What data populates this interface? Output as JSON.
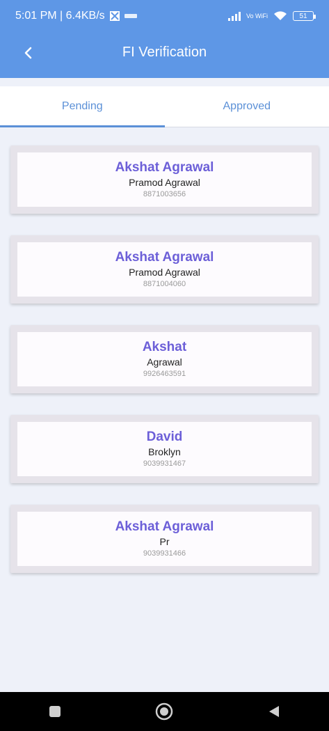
{
  "status_bar": {
    "time": "5:01 PM | 6.4KB/s",
    "vo_wifi": "Vo WiFi",
    "battery": "51"
  },
  "header": {
    "title": "FI Verification"
  },
  "tabs": [
    {
      "label": "Pending",
      "active": true
    },
    {
      "label": "Approved",
      "active": false
    }
  ],
  "records": [
    {
      "name": "Akshat Agrawal",
      "father": "Pramod Agrawal",
      "phone": "8871003656"
    },
    {
      "name": "Akshat Agrawal",
      "father": "Pramod Agrawal",
      "phone": "8871004060"
    },
    {
      "name": "Akshat",
      "father": "Agrawal",
      "phone": "9926463591"
    },
    {
      "name": "David",
      "father": "Broklyn",
      "phone": "9039931467"
    },
    {
      "name": "Akshat Agrawal",
      "father": "Pr",
      "phone": "9039931466"
    }
  ],
  "colors": {
    "header_bg": "#5e97e6",
    "accent": "#5b90d7",
    "name_color": "#6c5fd8"
  }
}
